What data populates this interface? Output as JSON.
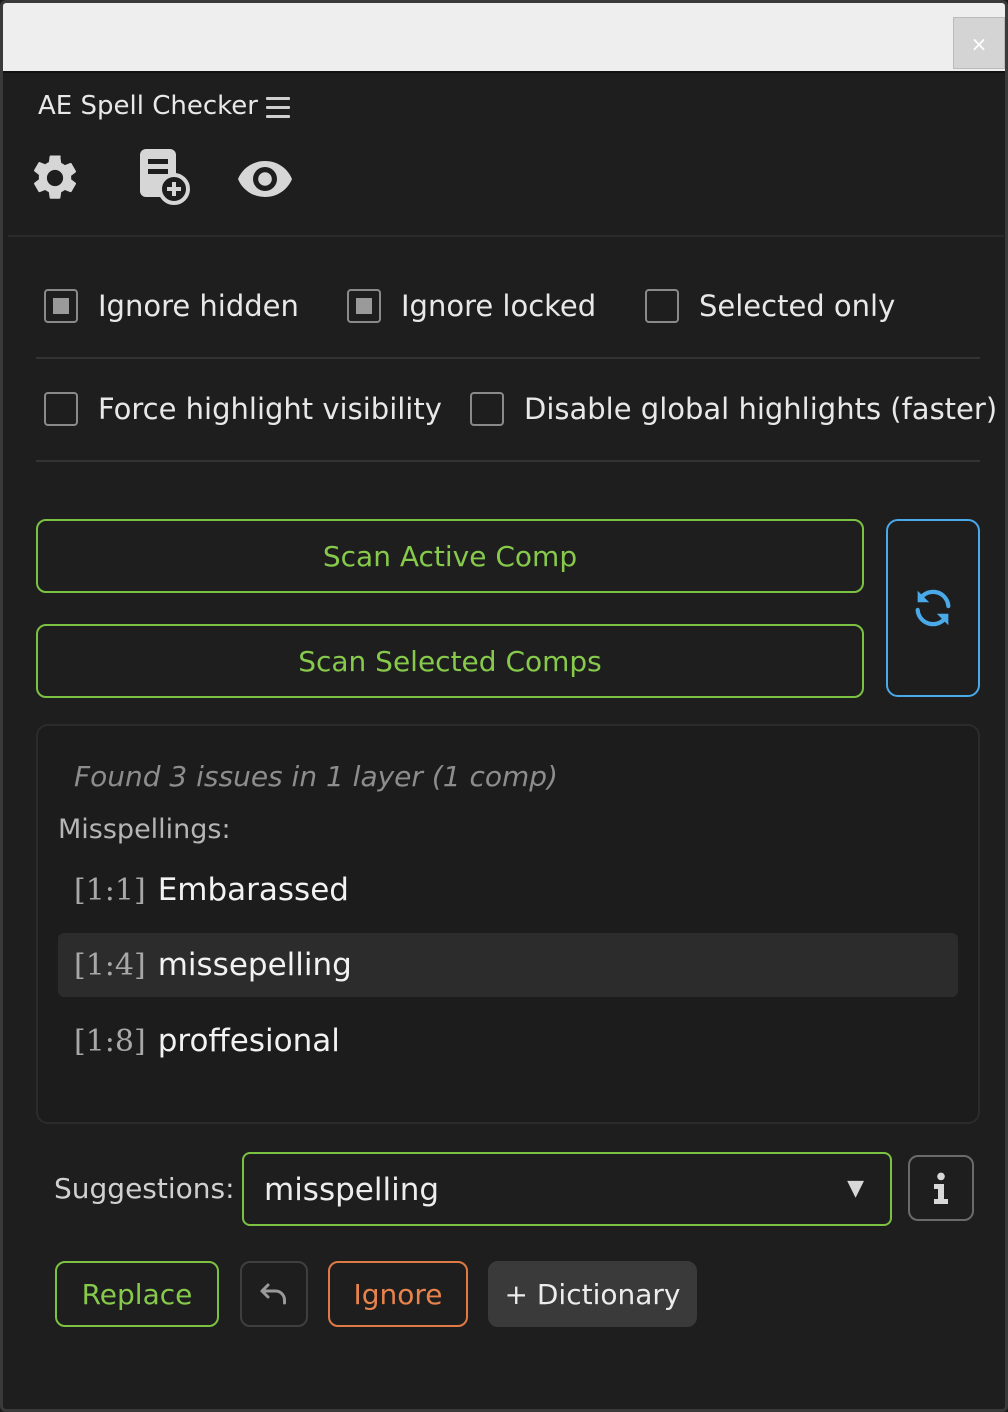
{
  "window": {
    "close_glyph": "×"
  },
  "panel": {
    "title": "AE Spell Checker"
  },
  "toolbar": {
    "icons": [
      "gear-icon",
      "dictionary-add-icon",
      "eye-icon"
    ]
  },
  "options": {
    "ignore_hidden": {
      "label": "Ignore hidden",
      "checked": true
    },
    "ignore_locked": {
      "label": "Ignore locked",
      "checked": true
    },
    "selected_only": {
      "label": "Selected only",
      "checked": false
    },
    "force_highlight": {
      "label": "Force highlight visibility",
      "checked": false
    },
    "disable_global": {
      "label": "Disable global highlights (faster)",
      "checked": false
    }
  },
  "scan": {
    "active_label": "Scan Active Comp",
    "selected_label": "Scan Selected Comps"
  },
  "results": {
    "summary": "Found 3 issues in 1 layer (1 comp)",
    "heading": "Misspellings:",
    "issues": [
      {
        "pos": "[1:1]",
        "word": "Embarassed",
        "selected": false
      },
      {
        "pos": "[1:4]",
        "word": "missepelling",
        "selected": true
      },
      {
        "pos": "[1:8]",
        "word": "proffesional",
        "selected": false
      }
    ]
  },
  "suggestions": {
    "label": "Suggestions:",
    "value": "misspelling",
    "arrow": "▼"
  },
  "actions": {
    "replace_label": "Replace",
    "ignore_label": "Ignore",
    "dictionary_label": "+ Dictionary"
  },
  "colors": {
    "accent_green": "#7cc242",
    "accent_blue": "#4aa9e8",
    "accent_orange": "#e07a45"
  }
}
